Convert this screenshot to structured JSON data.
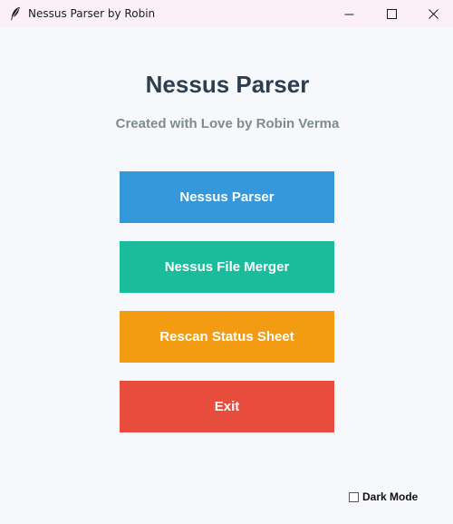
{
  "window": {
    "title": "Nessus Parser by Robin"
  },
  "header": {
    "title": "Nessus Parser",
    "subtitle": "Created with Love by Robin Verma"
  },
  "buttons": [
    {
      "label": "Nessus Parser",
      "color": "#3498db"
    },
    {
      "label": "Nessus File Merger",
      "color": "#1abc9c"
    },
    {
      "label": "Rescan Status Sheet",
      "color": "#f39c12"
    },
    {
      "label": "Exit",
      "color": "#e74c3c"
    }
  ],
  "dark_mode": {
    "label": "Dark Mode",
    "checked": false
  },
  "icons": {
    "app": "feather-icon",
    "minimize": "minimize-icon",
    "maximize": "maximize-icon",
    "close": "close-icon"
  }
}
